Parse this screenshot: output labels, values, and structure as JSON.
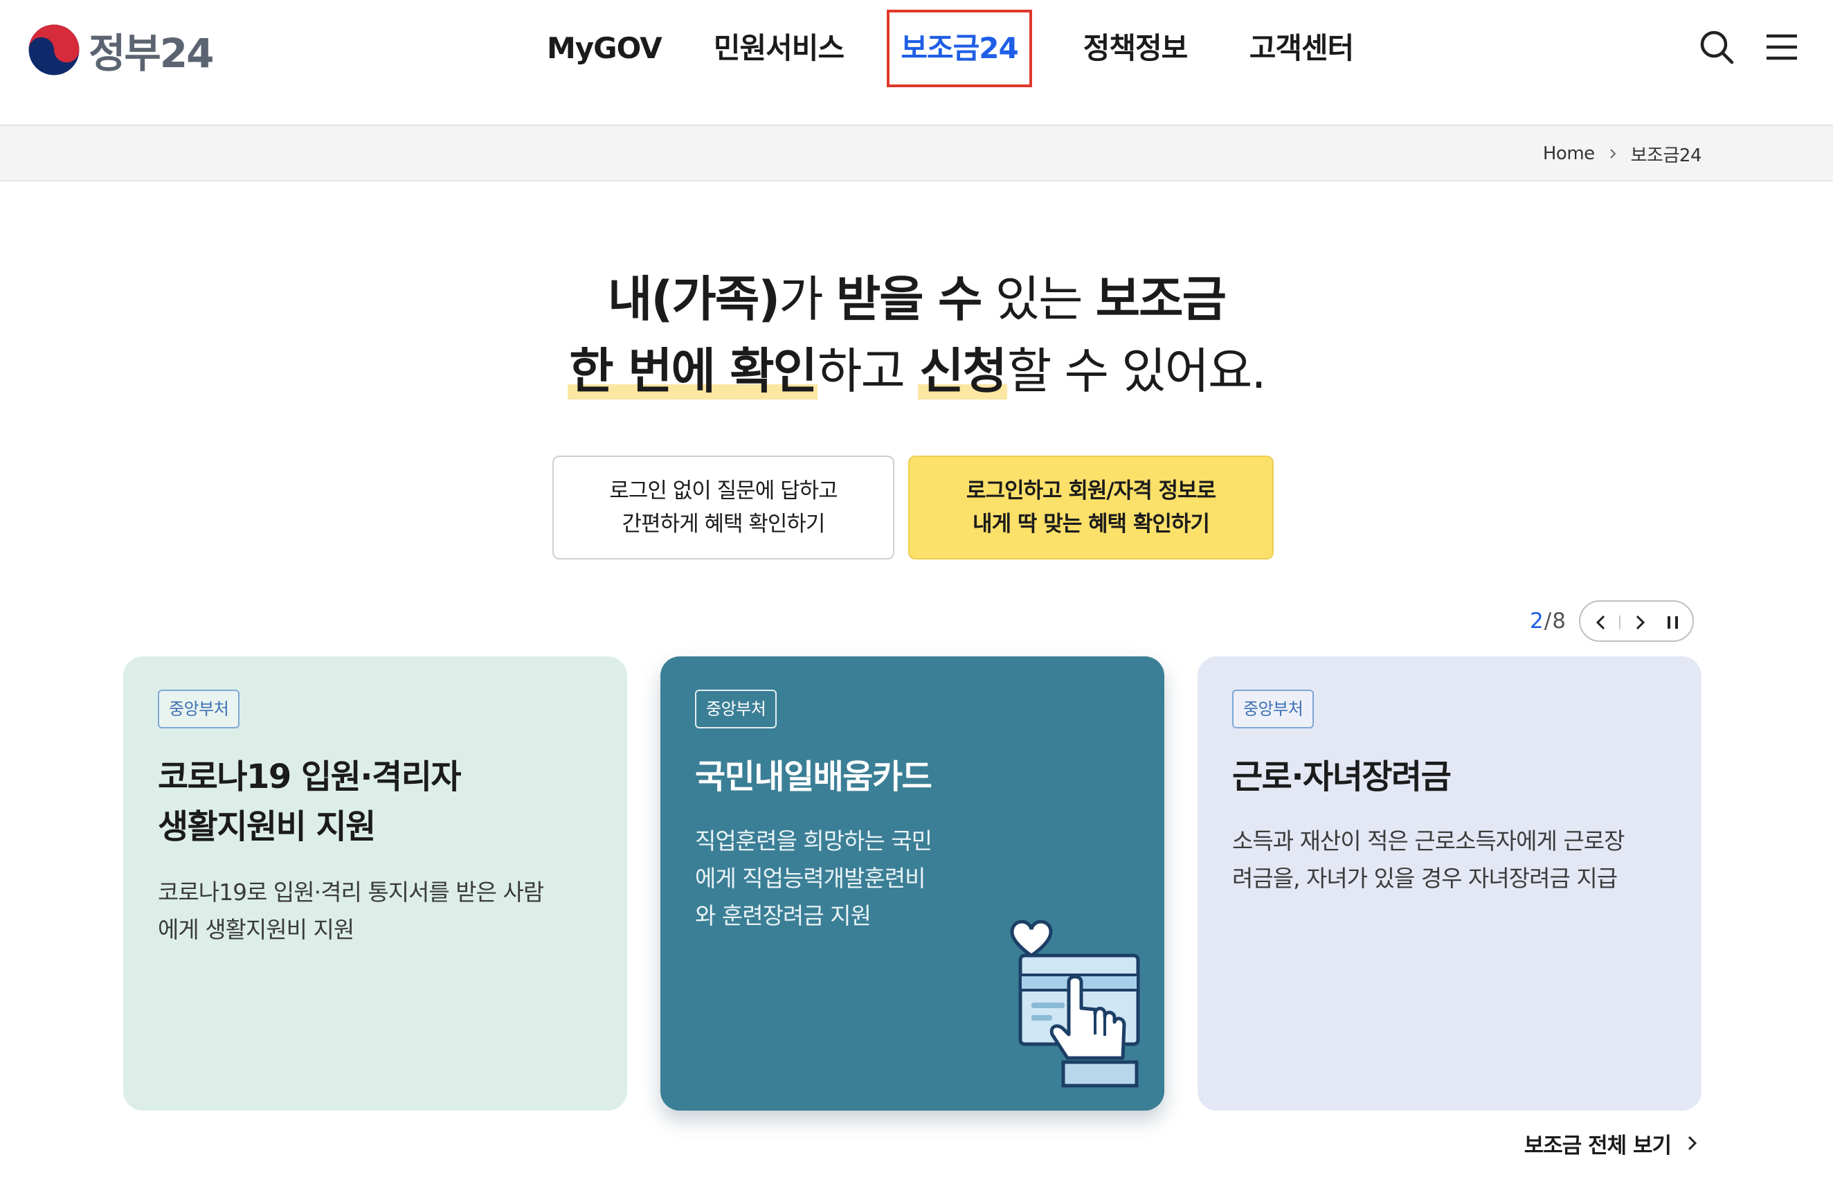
{
  "header": {
    "logo_text": "정부24",
    "nav": [
      {
        "label": "MyGOV"
      },
      {
        "label": "민원서비스"
      },
      {
        "label": "보조금24",
        "active": true
      },
      {
        "label": "정책정보"
      },
      {
        "label": "고객센터"
      }
    ],
    "search_icon": "search-icon",
    "menu_icon": "hamburger-menu-icon"
  },
  "breadcrumb": {
    "home": "Home",
    "current": "보조금24"
  },
  "hero": {
    "line1": {
      "a": "내(가족)",
      "b": "가 ",
      "c": "받을 수",
      "d": " 있는 ",
      "e": "보조금"
    },
    "line2": {
      "a": "한 번에 확인",
      "b": "하고 ",
      "c": "신청",
      "d": "할 수 있어요."
    }
  },
  "cta": {
    "guest": {
      "line1": "로그인 없이 질문에 답하고",
      "line2": "간편하게 혜택 확인하기"
    },
    "member": {
      "line1": "로그인하고 회원/자격 정보로",
      "line2": "내게 딱 맞는 혜택 확인하기"
    }
  },
  "pager": {
    "current": "2",
    "separator": "/",
    "total": "8"
  },
  "cards": [
    {
      "badge": "중앙부처",
      "title_line1": "코로나19 입원·격리자",
      "title_line2": "생활지원비 지원",
      "desc_line1": "코로나19로 입원·격리 통지서를 받은 사람",
      "desc_line2": "에게 생활지원비 지원"
    },
    {
      "badge": "중앙부처",
      "title_line1": "국민내일배움카드",
      "desc_line1": "직업훈련을 희망하는 국민",
      "desc_line2": "에게 직업능력개발훈련비",
      "desc_line3": "와 훈련장려금 지원"
    },
    {
      "badge": "중앙부처",
      "title_line1": "근로·자녀장려금",
      "desc_line1": "소득과 재산이 적은 근로소득자에게 근로장",
      "desc_line2": "려금을, 자녀가 있을 경우 자녀장려금 지급"
    }
  ],
  "view_all": "보조금 전체 보기",
  "colors": {
    "accent_blue": "#1f5ee6",
    "active_outline": "#e0382b",
    "cta_yellow": "#fbe06a",
    "card1_bg": "#ddeee9",
    "card2_bg": "#3b7f96",
    "card3_bg": "#e4e8f5",
    "highlight": "#fbe6a2"
  }
}
